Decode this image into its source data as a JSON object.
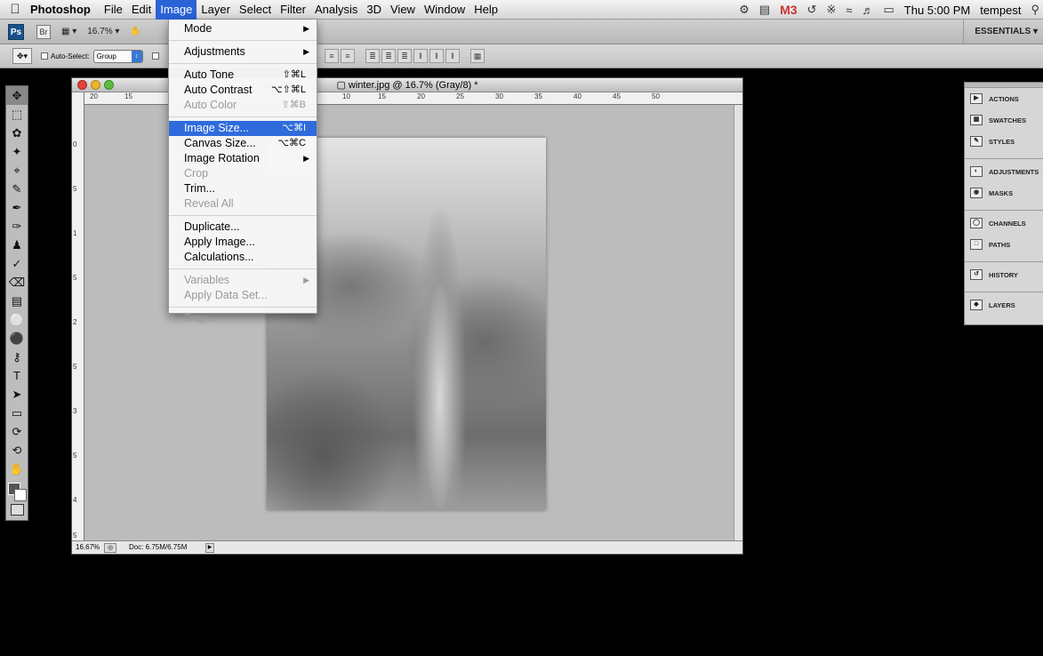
{
  "menubar": {
    "apple": "",
    "app_name": "Photoshop",
    "menus": [
      "File",
      "Edit",
      "Image",
      "Layer",
      "Select",
      "Filter",
      "Analysis",
      "3D",
      "View",
      "Window",
      "Help"
    ],
    "active_menu": "Image",
    "gmail_count": "3",
    "clock": "Thu 5:00 PM",
    "user": "tempest"
  },
  "appbar": {
    "ps_logo": "Ps",
    "br_logo": "Br",
    "zoom": "16.7%",
    "workspace": "ESSENTIALS"
  },
  "options": {
    "auto_select_label": "Auto-Select:",
    "auto_select_value": "Group"
  },
  "image_menu": {
    "items": [
      {
        "label": "Mode",
        "shortcut": "",
        "submenu": true,
        "disabled": false
      },
      {
        "label": "Adjustments",
        "shortcut": "",
        "submenu": true,
        "disabled": false
      },
      {
        "label": "Auto Tone",
        "shortcut": "⇧⌘L",
        "submenu": false,
        "disabled": false
      },
      {
        "label": "Auto Contrast",
        "shortcut": "⌥⇧⌘L",
        "submenu": false,
        "disabled": false
      },
      {
        "label": "Auto Color",
        "shortcut": "⇧⌘B",
        "submenu": false,
        "disabled": true
      },
      {
        "label": "Image Size...",
        "shortcut": "⌥⌘I",
        "submenu": false,
        "disabled": false,
        "highlighted": true
      },
      {
        "label": "Canvas Size...",
        "shortcut": "⌥⌘C",
        "submenu": false,
        "disabled": false
      },
      {
        "label": "Image Rotation",
        "shortcut": "",
        "submenu": true,
        "disabled": false
      },
      {
        "label": "Crop",
        "shortcut": "",
        "submenu": false,
        "disabled": true
      },
      {
        "label": "Trim...",
        "shortcut": "",
        "submenu": false,
        "disabled": false
      },
      {
        "label": "Reveal All",
        "shortcut": "",
        "submenu": false,
        "disabled": true
      },
      {
        "label": "Duplicate...",
        "shortcut": "",
        "submenu": false,
        "disabled": false
      },
      {
        "label": "Apply Image...",
        "shortcut": "",
        "submenu": false,
        "disabled": false
      },
      {
        "label": "Calculations...",
        "shortcut": "",
        "submenu": false,
        "disabled": false
      },
      {
        "label": "Variables",
        "shortcut": "",
        "submenu": true,
        "disabled": true
      },
      {
        "label": "Apply Data Set...",
        "shortcut": "",
        "submenu": false,
        "disabled": true
      },
      {
        "label": "Trap...",
        "shortcut": "",
        "submenu": false,
        "disabled": true
      }
    ]
  },
  "document": {
    "title": "winter.jpg @ 16.7% (Gray/8) *",
    "zoom_status": "16.67%",
    "doc_status": "Doc: 6.75M/6.75M",
    "hruler_ticks": [
      "20",
      "15",
      "10",
      "15",
      "20",
      "25",
      "30",
      "35",
      "40",
      "45",
      "50"
    ],
    "vruler_ticks": [
      "0",
      "5",
      "1",
      "5",
      "2",
      "5",
      "3",
      "5",
      "4",
      "5"
    ]
  },
  "panels": {
    "items": [
      {
        "label": "ACTIONS",
        "icon": "play-icon"
      },
      {
        "label": "SWATCHES",
        "icon": "grid-icon"
      },
      {
        "label": "STYLES",
        "icon": "styles-icon"
      },
      {
        "label": "ADJUSTMENTS",
        "icon": "circle-icon"
      },
      {
        "label": "MASKS",
        "icon": "mask-icon"
      },
      {
        "label": "CHANNELS",
        "icon": "channels-icon"
      },
      {
        "label": "PATHS",
        "icon": "paths-icon"
      },
      {
        "label": "HISTORY",
        "icon": "history-icon"
      },
      {
        "label": "LAYERS",
        "icon": "layers-icon"
      }
    ]
  },
  "colors": {
    "menu_highlight": "#2f6bdc",
    "foreground_swatch": "#555555",
    "background_swatch": "#ffffff"
  }
}
